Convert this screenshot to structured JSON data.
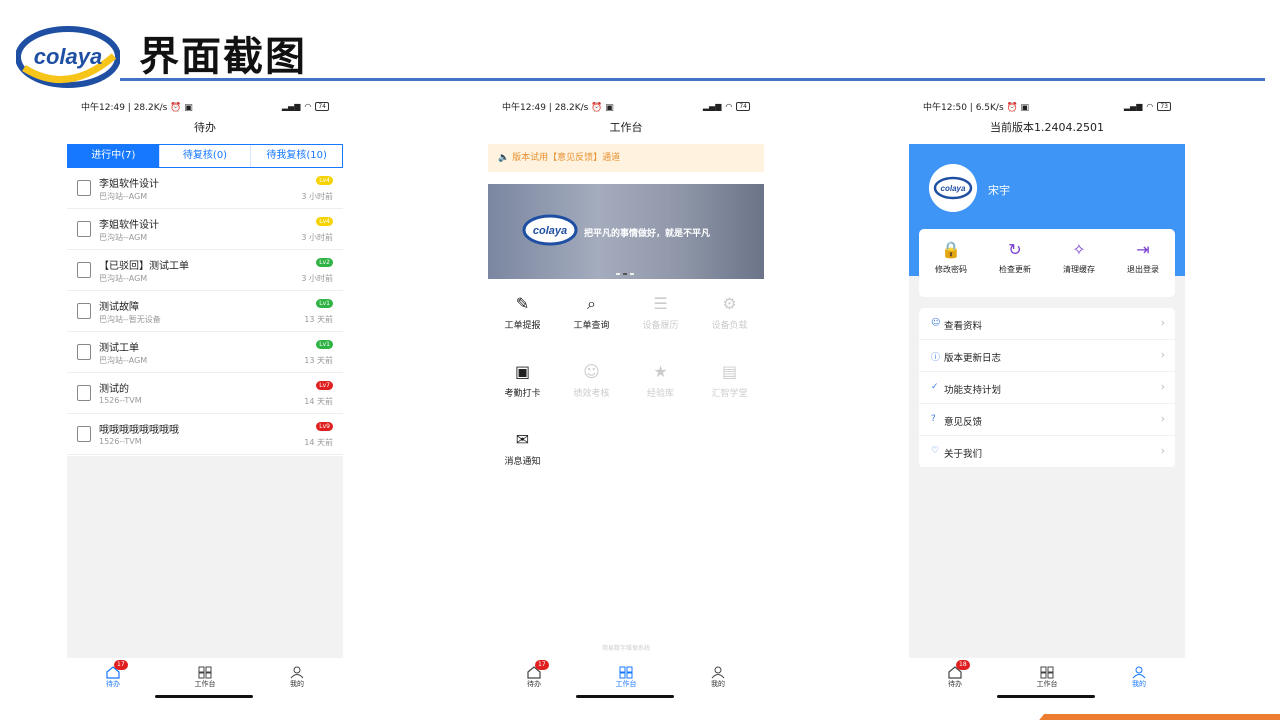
{
  "slide": {
    "title": "界面截图",
    "logo_text": "colaya"
  },
  "colors": {
    "brand_blue": "#1677ff",
    "header_blue": "#3e95f5",
    "rule_blue": "#4472c4",
    "accent_orange": "#ed7d31"
  },
  "phone1": {
    "status_left": "中午12:49 | 28.2K/s ⏰ ▣",
    "battery": "74",
    "title": "待办",
    "tabs": [
      "进行中(7)",
      "待复核(0)",
      "待我复核(10)"
    ],
    "items": [
      {
        "title": "李姐软件设计",
        "sub": "巴沟站--AGM",
        "level": "Lv4",
        "level_color": "#f5d300",
        "time": "3 小时前"
      },
      {
        "title": "李姐软件设计",
        "sub": "巴沟站--AGM",
        "level": "Lv4",
        "level_color": "#f5d300",
        "time": "3 小时前"
      },
      {
        "title": "【已驳回】测试工单",
        "sub": "巴沟站--AGM",
        "level": "Lv2",
        "level_color": "#2fb344",
        "time": "3 小时前"
      },
      {
        "title": "测试故障",
        "sub": "巴沟站--暂无设备",
        "level": "Lv1",
        "level_color": "#2fb344",
        "time": "13 天前"
      },
      {
        "title": "测试工单",
        "sub": "巴沟站--AGM",
        "level": "Lv1",
        "level_color": "#2fb344",
        "time": "13 天前"
      },
      {
        "title": "测试的",
        "sub": "1526--TVM",
        "level": "Lv7",
        "level_color": "#e02020",
        "time": "14 天前"
      },
      {
        "title": "哦哦哦哦哦哦哦哦",
        "sub": "1526--TVM",
        "level": "Lv9",
        "level_color": "#e02020",
        "time": "14 天前"
      }
    ],
    "nav": [
      {
        "label": "待办",
        "badge": "17"
      },
      {
        "label": "工作台"
      },
      {
        "label": "我的"
      }
    ]
  },
  "phone2": {
    "status_left": "中午12:49 | 28.2K/s ⏰ ▣",
    "battery": "74",
    "title": "工作台",
    "notice": "版本试用【意见反馈】通道",
    "banner_text": "把平凡的事情做好，就是不平凡",
    "grid": [
      {
        "label": "工单提报",
        "icon": "edit-icon",
        "glyph": "✎",
        "dim": false
      },
      {
        "label": "工单查询",
        "icon": "search-icon",
        "glyph": "⌕",
        "dim": false
      },
      {
        "label": "设备履历",
        "icon": "list-icon",
        "glyph": "☰",
        "dim": true
      },
      {
        "label": "设备负载",
        "icon": "gear-icon",
        "glyph": "⚙",
        "dim": true
      },
      {
        "label": "考勤打卡",
        "icon": "clipboard-icon",
        "glyph": "▣",
        "dim": false
      },
      {
        "label": "绩效考核",
        "icon": "user-check-icon",
        "glyph": "☺",
        "dim": true
      },
      {
        "label": "经验库",
        "icon": "star-icon",
        "glyph": "★",
        "dim": true
      },
      {
        "label": "汇智学堂",
        "icon": "wallet-icon",
        "glyph": "▤",
        "dim": true
      },
      {
        "label": "消息通知",
        "icon": "chat-icon",
        "glyph": "✉",
        "dim": false
      }
    ],
    "footer_note": "简易数字维保系统",
    "nav": [
      {
        "label": "待办",
        "badge": "17"
      },
      {
        "label": "工作台"
      },
      {
        "label": "我的"
      }
    ]
  },
  "phone3": {
    "status_left": "中午12:50 | 6.5K/s ⏰ ▣",
    "battery": "73",
    "title": "当前版本1.2404.2501",
    "user_name": "宋宇",
    "actions": [
      {
        "label": "修改密码",
        "icon": "lock-icon",
        "glyph": "🔒"
      },
      {
        "label": "检查更新",
        "icon": "refresh-icon",
        "glyph": "↻"
      },
      {
        "label": "清理缓存",
        "icon": "broom-icon",
        "glyph": "✧"
      },
      {
        "label": "退出登录",
        "icon": "logout-icon",
        "glyph": "⇥"
      }
    ],
    "menu": [
      {
        "label": "查看资料",
        "icon": "user-icon",
        "glyph": "☺"
      },
      {
        "label": "版本更新日志",
        "icon": "info-icon",
        "glyph": "ⓘ"
      },
      {
        "label": "功能支持计划",
        "icon": "shield-icon",
        "glyph": "✓"
      },
      {
        "label": "意见反馈",
        "icon": "help-icon",
        "glyph": "?"
      },
      {
        "label": "关于我们",
        "icon": "heart-icon",
        "glyph": "♡"
      }
    ],
    "nav": [
      {
        "label": "待办",
        "badge": "18"
      },
      {
        "label": "工作台"
      },
      {
        "label": "我的"
      }
    ]
  }
}
